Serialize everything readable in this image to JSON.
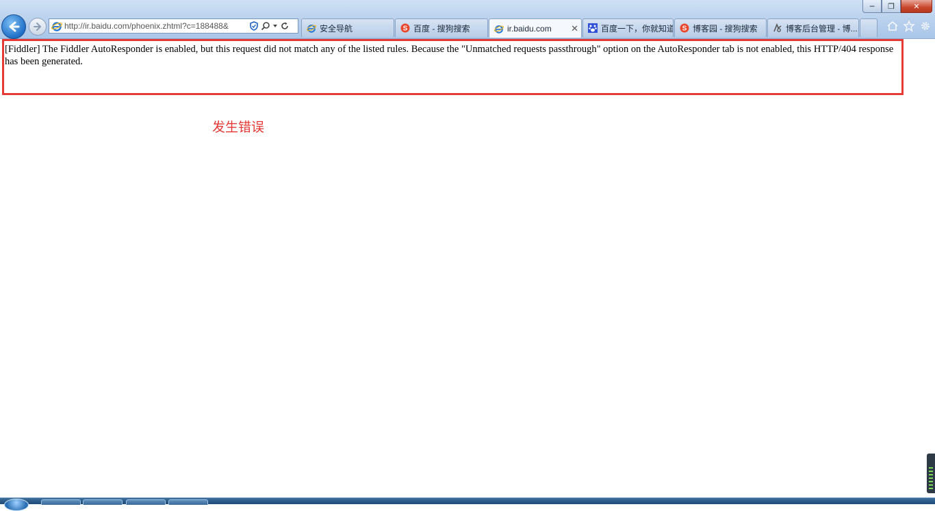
{
  "browser": {
    "address_url": "http://ir.baidu.com/phoenix.zhtml?c=188488&",
    "tabs": [
      {
        "label": "安全导航",
        "favicon": "ie-icon",
        "active": false
      },
      {
        "label": "百度 - 搜狗搜索",
        "favicon": "sogou-icon",
        "active": false
      },
      {
        "label": "ir.baidu.com",
        "favicon": "ie-icon",
        "active": true
      },
      {
        "label": "百度一下，你就知道",
        "favicon": "baidu-paw-icon",
        "active": false
      },
      {
        "label": "博客园 - 搜狗搜索",
        "favicon": "sogou-icon",
        "active": false
      },
      {
        "label": "博客后台管理 - 博...",
        "favicon": "blog-icon",
        "active": false
      }
    ],
    "accent_color": "#e53935"
  },
  "content": {
    "message": "[Fiddler] The Fiddler AutoResponder is enabled, but this request did not match any of the listed rules. Because the \"Unmatched requests passthrough\" option on the AutoResponder tab is not enabled, this HTTP/404 response has been generated.",
    "annotation": "发生错误"
  }
}
